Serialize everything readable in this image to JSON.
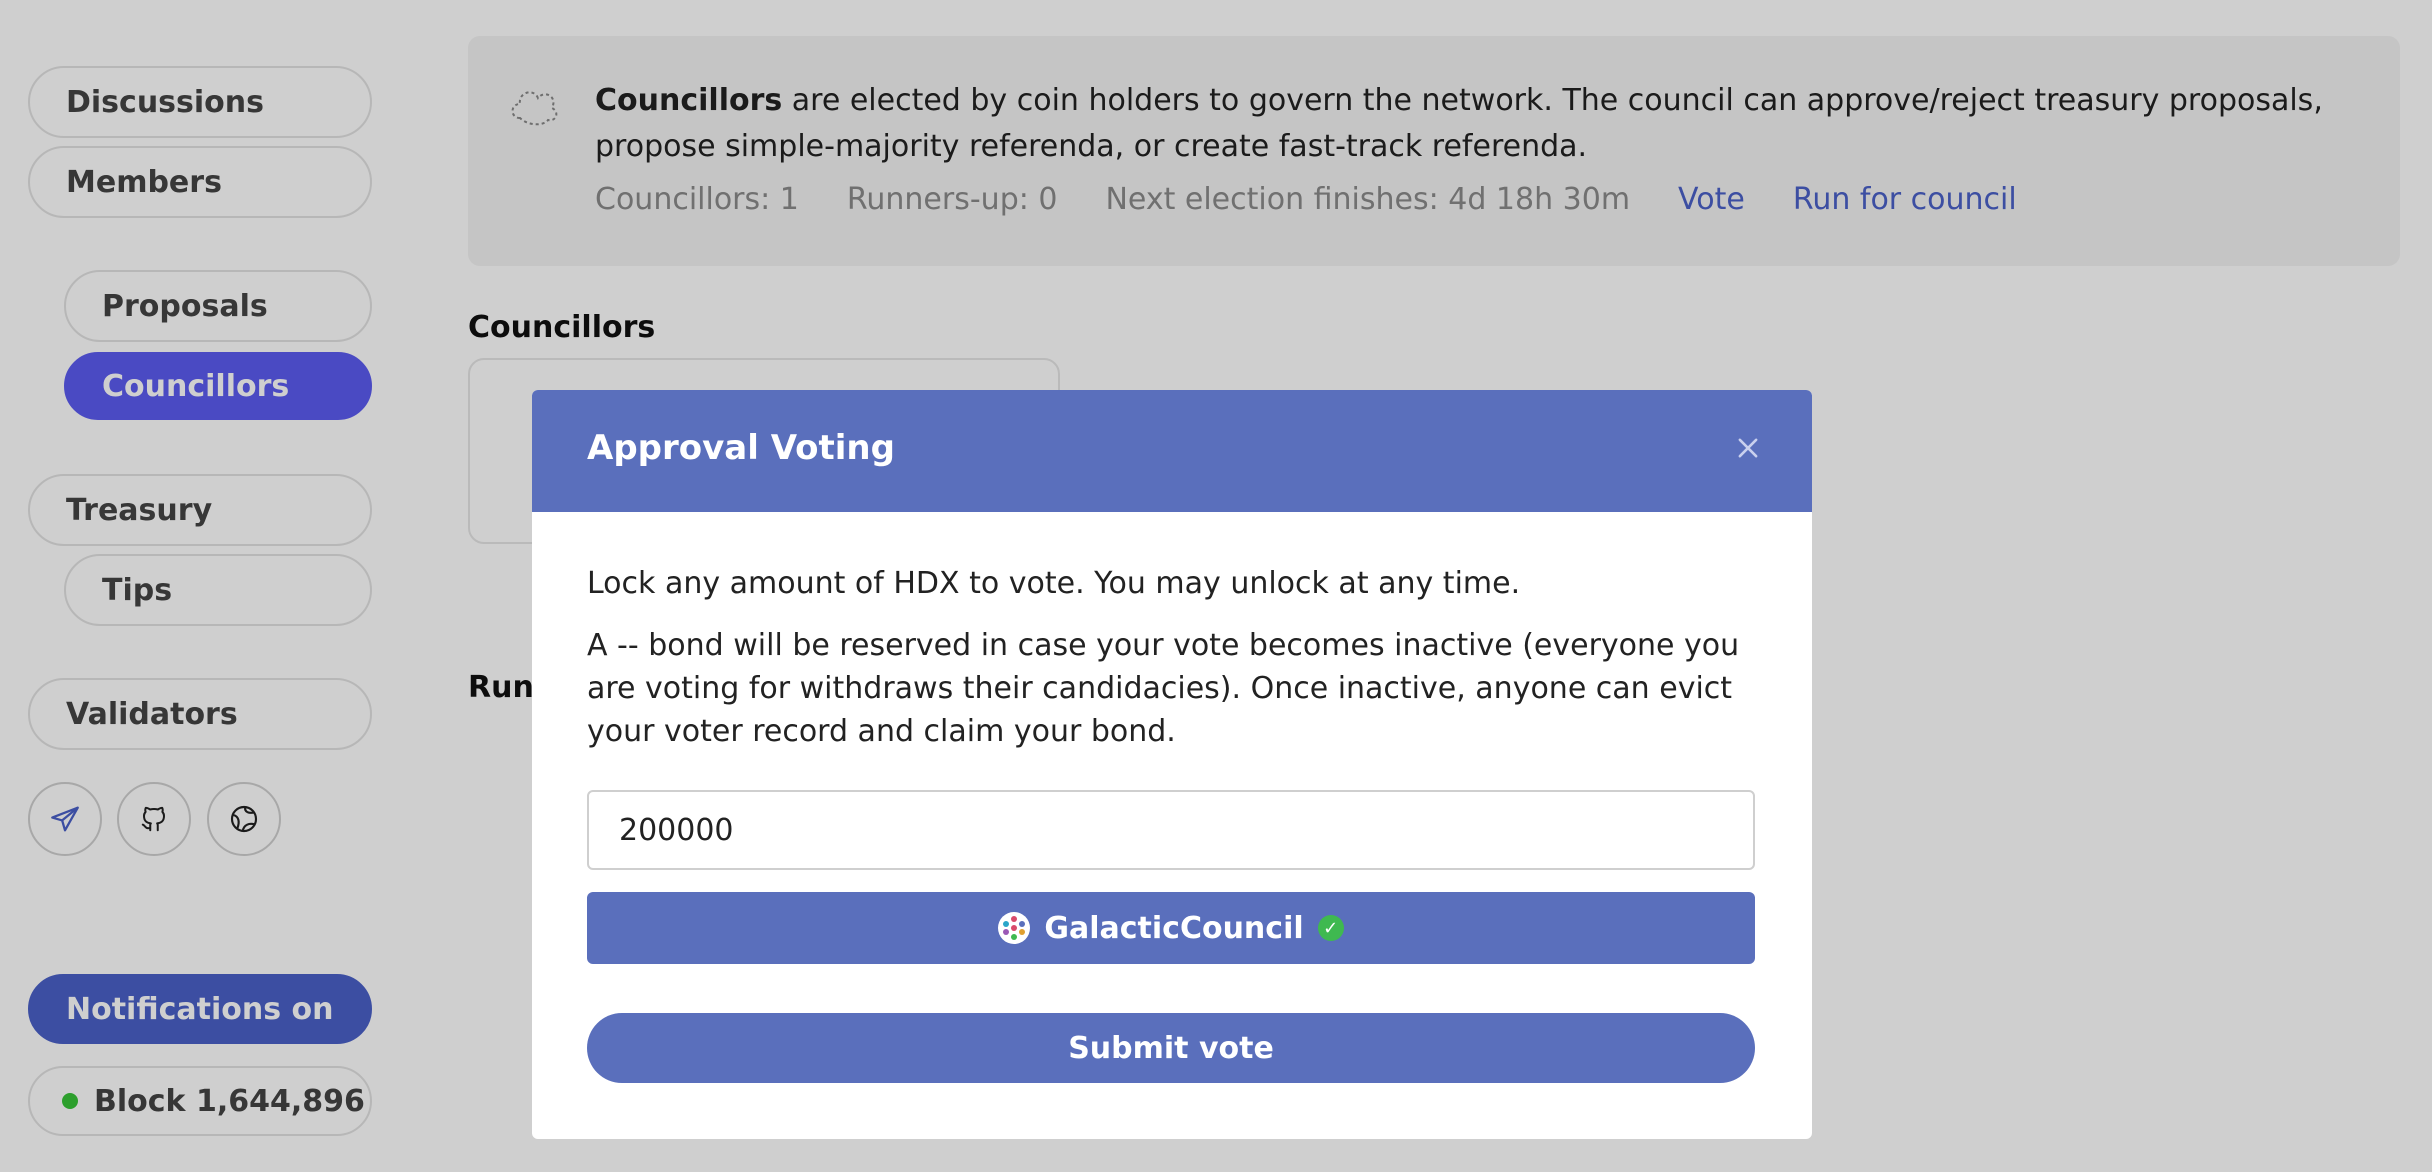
{
  "sidebar": {
    "items": [
      {
        "label": "Discussions"
      },
      {
        "label": "Members"
      },
      {
        "label": "Proposals"
      },
      {
        "label": "Councillors"
      },
      {
        "label": "Treasury"
      },
      {
        "label": "Tips"
      },
      {
        "label": "Validators"
      }
    ],
    "social_icons": [
      "telegram-icon",
      "github-icon",
      "globe-icon"
    ],
    "notifications_label": "Notifications on",
    "block_label": "Block 1,644,896"
  },
  "banner": {
    "title_bold": "Councillors",
    "description": "are elected by coin holders to govern the network. The council can approve/reject treasury proposals, propose simple-majority referenda, or create fast-track referenda.",
    "councillors_count": "Councillors: 1",
    "runners_up_count": "Runners-up: 0",
    "next_election": "Next election finishes: 4d 18h 30m",
    "vote_link": "Vote",
    "run_link": "Run for council"
  },
  "main": {
    "councillors_heading": "Councillors",
    "runners_heading": "Runners-up"
  },
  "modal": {
    "title": "Approval Voting",
    "intro": "Lock any amount of HDX to vote. You may unlock at any time.",
    "bond_notice": "A -- bond will be reserved in case your vote becomes inactive (everyone you are voting for withdraws their candidacies). Once inactive, anyone can evict your voter record and claim your bond.",
    "amount_value": "200000",
    "candidate_name": "GalacticCouncil",
    "submit_label": "Submit vote"
  },
  "colors": {
    "accent": "#5a6fbc",
    "active_nav": "#5c5cf0",
    "notifications": "#4b61c8",
    "status_green": "#38c438"
  }
}
